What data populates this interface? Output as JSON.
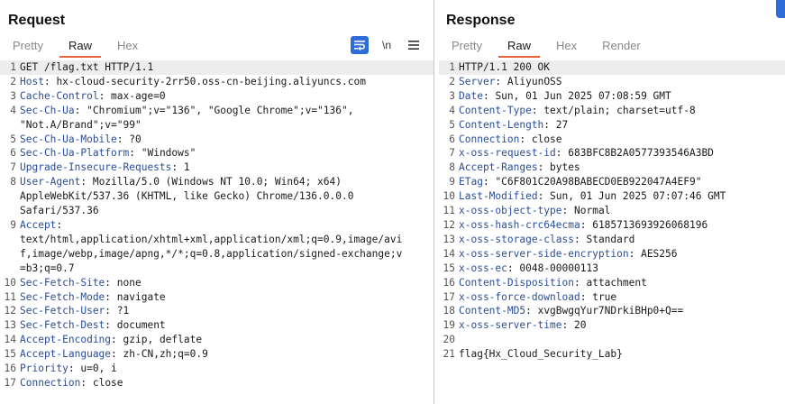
{
  "request": {
    "title": "Request",
    "tabs": [
      "Pretty",
      "Raw",
      "Hex"
    ],
    "active_tab": "Raw",
    "tools": {
      "wrap_icon": "wrap-lines-icon",
      "newline_label": "\\n",
      "menu_icon": "hamburger-menu-icon"
    },
    "lines": [
      {
        "n": "1",
        "text": "GET /flag.txt HTTP/1.1"
      },
      {
        "n": "2",
        "name": "Host",
        "value": " hx-cloud-security-2rr50.oss-cn-beijing.aliyuncs.com"
      },
      {
        "n": "3",
        "name": "Cache-Control",
        "value": " max-age=0"
      },
      {
        "n": "4",
        "name": "Sec-Ch-Ua",
        "value": " \"Chromium\";v=\"136\", \"Google Chrome\";v=\"136\",\n\"Not.A/Brand\";v=\"99\""
      },
      {
        "n": "5",
        "name": "Sec-Ch-Ua-Mobile",
        "value": " ?0"
      },
      {
        "n": "6",
        "name": "Sec-Ch-Ua-Platform",
        "value": " \"Windows\""
      },
      {
        "n": "7",
        "name": "Upgrade-Insecure-Requests",
        "value": " 1"
      },
      {
        "n": "8",
        "name": "User-Agent",
        "value": " Mozilla/5.0 (Windows NT 10.0; Win64; x64)\nAppleWebKit/537.36 (KHTML, like Gecko) Chrome/136.0.0.0\nSafari/537.36"
      },
      {
        "n": "9",
        "name": "Accept",
        "value": "\ntext/html,application/xhtml+xml,application/xml;q=0.9,image/avi\nf,image/webp,image/apng,*/*;q=0.8,application/signed-exchange;v\n=b3;q=0.7"
      },
      {
        "n": "10",
        "name": "Sec-Fetch-Site",
        "value": " none"
      },
      {
        "n": "11",
        "name": "Sec-Fetch-Mode",
        "value": " navigate"
      },
      {
        "n": "12",
        "name": "Sec-Fetch-User",
        "value": " ?1"
      },
      {
        "n": "13",
        "name": "Sec-Fetch-Dest",
        "value": " document"
      },
      {
        "n": "14",
        "name": "Accept-Encoding",
        "value": " gzip, deflate"
      },
      {
        "n": "15",
        "name": "Accept-Language",
        "value": " zh-CN,zh;q=0.9"
      },
      {
        "n": "16",
        "name": "Priority",
        "value": " u=0, i"
      },
      {
        "n": "17",
        "name": "Connection",
        "value": " close"
      }
    ]
  },
  "response": {
    "title": "Response",
    "tabs": [
      "Pretty",
      "Raw",
      "Hex",
      "Render"
    ],
    "active_tab": "Raw",
    "lines": [
      {
        "n": "1",
        "text": "HTTP/1.1 200 OK"
      },
      {
        "n": "2",
        "name": "Server",
        "value": " AliyunOSS"
      },
      {
        "n": "3",
        "name": "Date",
        "value": " Sun, 01 Jun 2025 07:08:59 GMT"
      },
      {
        "n": "4",
        "name": "Content-Type",
        "value": " text/plain; charset=utf-8"
      },
      {
        "n": "5",
        "name": "Content-Length",
        "value": " 27"
      },
      {
        "n": "6",
        "name": "Connection",
        "value": " close"
      },
      {
        "n": "7",
        "name": "x-oss-request-id",
        "value": " 683BFC8B2A0577393546A3BD"
      },
      {
        "n": "8",
        "name": "Accept-Ranges",
        "value": " bytes"
      },
      {
        "n": "9",
        "name": "ETag",
        "value": " \"C6F801C20A98BABECD0EB922047A4EF9\""
      },
      {
        "n": "10",
        "name": "Last-Modified",
        "value": " Sun, 01 Jun 2025 07:07:46 GMT"
      },
      {
        "n": "11",
        "name": "x-oss-object-type",
        "value": " Normal"
      },
      {
        "n": "12",
        "name": "x-oss-hash-crc64ecma",
        "value": " 6185713693926068196"
      },
      {
        "n": "13",
        "name": "x-oss-storage-class",
        "value": " Standard"
      },
      {
        "n": "14",
        "name": "x-oss-server-side-encryption",
        "value": " AES256"
      },
      {
        "n": "15",
        "name": "x-oss-ec",
        "value": " 0048-00000113"
      },
      {
        "n": "16",
        "name": "Content-Disposition",
        "value": " attachment"
      },
      {
        "n": "17",
        "name": "x-oss-force-download",
        "value": " true"
      },
      {
        "n": "18",
        "name": "Content-MD5",
        "value": " xvgBwgqYur7NDrkiBHp0+Q=="
      },
      {
        "n": "19",
        "name": "x-oss-server-time",
        "value": " 20"
      },
      {
        "n": "20",
        "text": ""
      },
      {
        "n": "21",
        "text": "flag{Hx_Cloud_Security_Lab}"
      }
    ]
  },
  "colors": {
    "accent_tab": "#e8643a",
    "header_name": "#2a4e9a",
    "tool_active": "#2e6dd8"
  }
}
